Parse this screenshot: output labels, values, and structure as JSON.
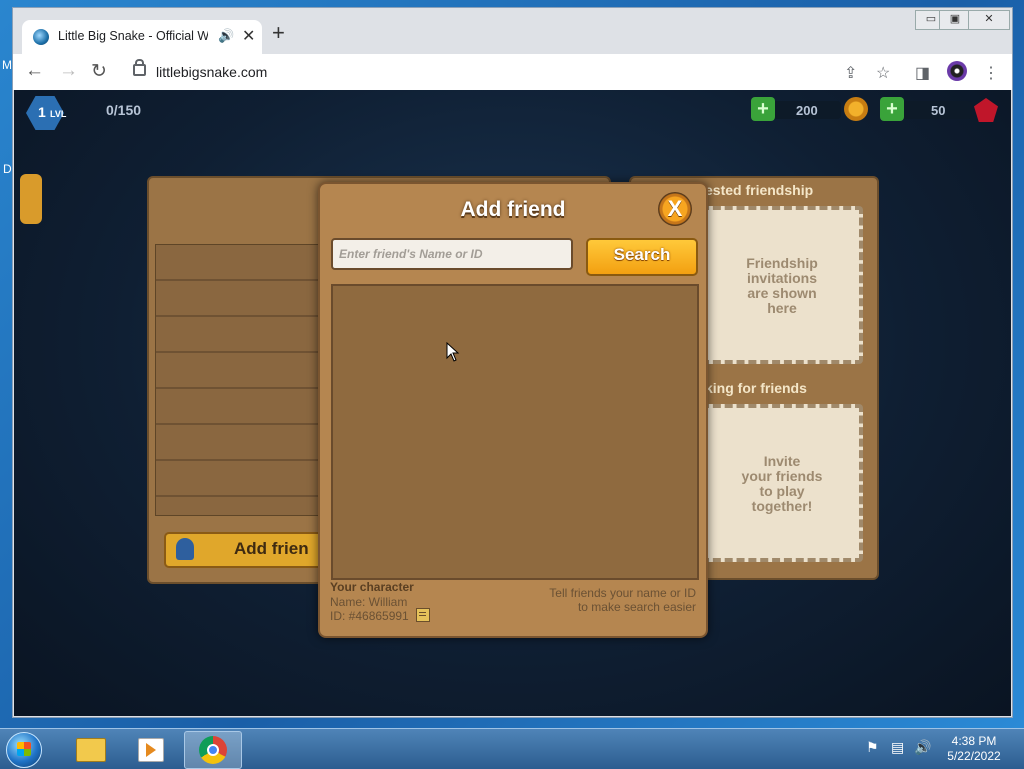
{
  "desktop": {
    "fragment_top": "M",
    "fragment_mid": "D"
  },
  "browser": {
    "tab_title": "Little Big Snake - Official We",
    "tab_audio_icon": "speaker-icon",
    "tab_close": "✕",
    "new_tab": "+",
    "url": "littlebigsnake.com",
    "window_controls": [
      "▭",
      "▣",
      "✕"
    ]
  },
  "game": {
    "hud": {
      "level": "1",
      "level_unit": "LVL",
      "xp": "0/150",
      "coins": "200",
      "gems": "50"
    },
    "left_panel": {
      "add_friend_label": "Add frien"
    },
    "right_panel": {
      "requested_title": "ested friendship",
      "requested_text": [
        "Friendship",
        "invitations",
        "are shown",
        "here"
      ],
      "looking_title": "king for friends",
      "looking_text": [
        "Invite",
        "your friends",
        "to play",
        "together!"
      ]
    },
    "modal": {
      "title": "Add friend",
      "close_symbol": "X",
      "search_placeholder": "Enter friend's Name or ID",
      "search_button": "Search",
      "character_heading": "Your character",
      "character_name": "Name: William",
      "character_id": "ID: #46865991",
      "hint_line1": "Tell friends your name or ID",
      "hint_line2": "to make search easier"
    }
  },
  "taskbar": {
    "time": "4:38 PM",
    "date": "5/22/2022"
  }
}
